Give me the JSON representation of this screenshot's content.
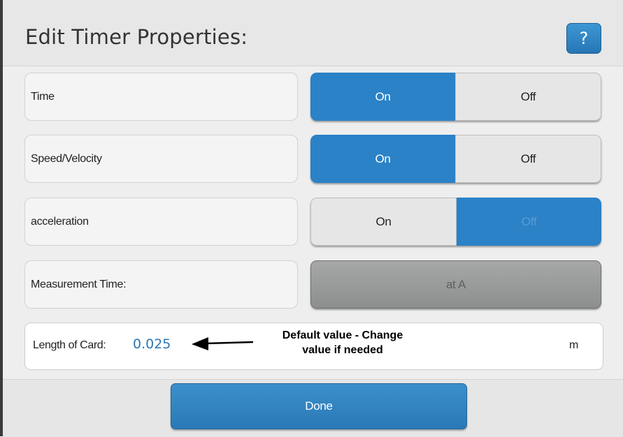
{
  "dialog": {
    "title": "Edit Timer Properties:",
    "help_label": "?"
  },
  "rows": [
    {
      "label": "Time",
      "on_label": "On",
      "off_label": "Off",
      "selected": "On"
    },
    {
      "label": "Speed/Velocity",
      "on_label": "On",
      "off_label": "Off",
      "selected": "On"
    },
    {
      "label": "acceleration",
      "on_label": "On",
      "off_label": "Off",
      "selected": "Off"
    }
  ],
  "measurement": {
    "label": "Measurement Time:",
    "value": "at A"
  },
  "length": {
    "label": "Length of Card:",
    "value": "0.025",
    "unit": "m"
  },
  "annotation": {
    "line1": "Default value - Change",
    "line2": "value if needed"
  },
  "footer": {
    "done_label": "Done"
  },
  "colors": {
    "accent": "#2b82c7",
    "value_text": "#2b76b4"
  }
}
